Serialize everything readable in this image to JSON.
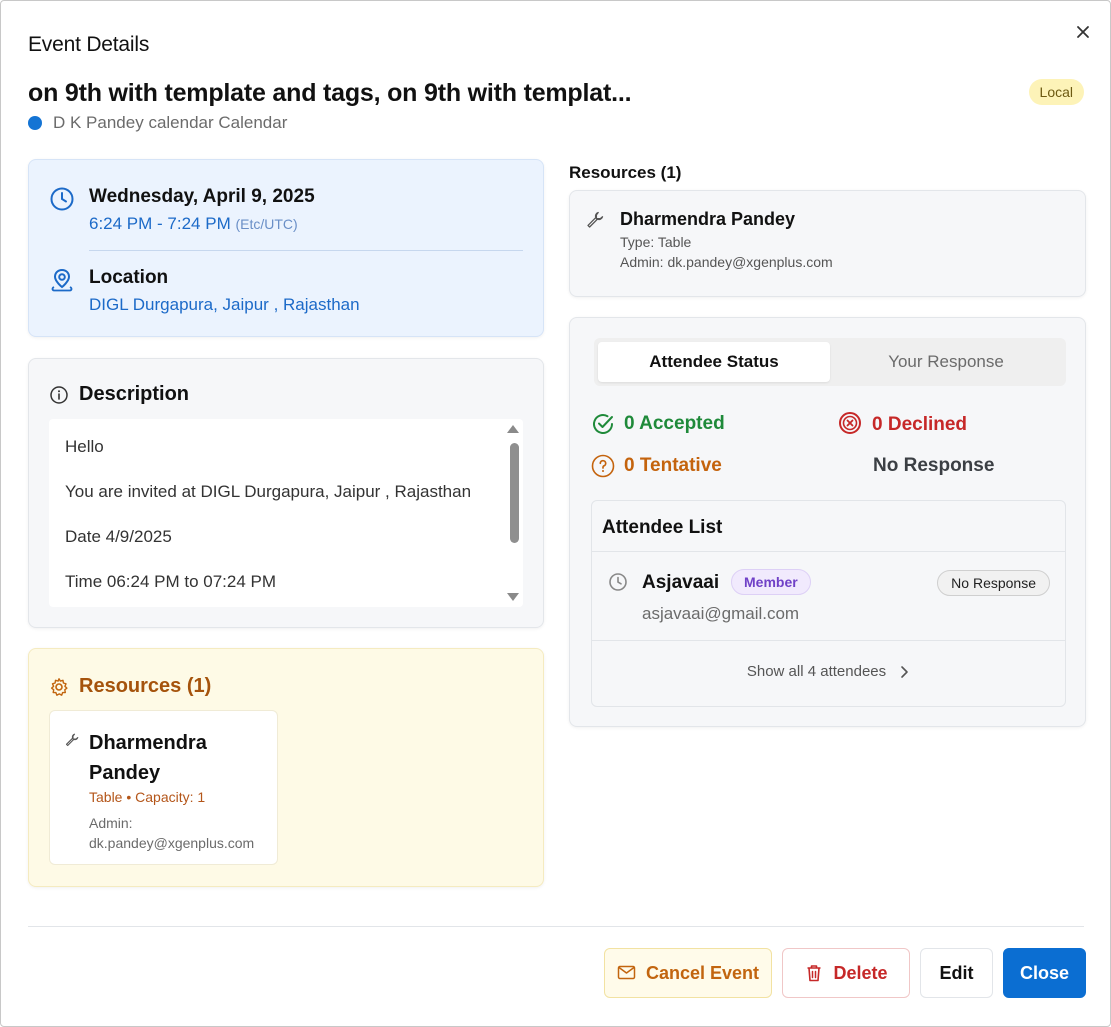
{
  "header": {
    "title": "Event Details"
  },
  "event": {
    "title": "on 9th with template and tags, on 9th with templat...",
    "badge": "Local",
    "calendar": "D K Pandey calendar Calendar"
  },
  "datetime": {
    "date": "Wednesday, April 9, 2025",
    "time": "6:24 PM - 7:24 PM",
    "timezone": "(Etc/UTC)"
  },
  "location": {
    "label": "Location",
    "value": "DIGL Durgapura, Jaipur , Rajasthan"
  },
  "description": {
    "label": "Description",
    "lines": [
      "Hello",
      "You are invited at DIGL Durgapura, Jaipur , Rajasthan",
      "Date 4/9/2025",
      "Time 06:24 PM to 07:24 PM"
    ]
  },
  "resources_left": {
    "label": "Resources (1)",
    "name": "Dharmendra Pandey",
    "meta": "Table • Capacity: 1",
    "admin_label": "Admin:",
    "admin_email": "dk.pandey@xgenplus.com"
  },
  "resources_right": {
    "label": "Resources (1)",
    "name": "Dharmendra Pandey",
    "type": "Type: Table",
    "admin": "Admin: dk.pandey@xgenplus.com"
  },
  "tabs": [
    {
      "label": "Attendee Status",
      "active": true
    },
    {
      "label": "Your Response",
      "active": false
    }
  ],
  "stats": {
    "accepted": "0 Accepted",
    "declined": "0 Declined",
    "tentative": "0 Tentative",
    "no_response": "No Response"
  },
  "attendee_list": {
    "title": "Attendee List",
    "attendees": [
      {
        "name": "Asjavaai",
        "role": "Member",
        "email": "asjavaai@gmail.com",
        "status": "No Response"
      }
    ],
    "show_all": "Show all 4 attendees"
  },
  "footer": {
    "cancel": "Cancel Event",
    "delete": "Delete",
    "edit": "Edit",
    "close": "Close"
  },
  "colors": {
    "primary": "#0b6ed2",
    "accepted": "#1f8a3a",
    "declined": "#c62828",
    "tentative": "#c4630d",
    "calendar_dot": "#1474d4"
  },
  "icons": {
    "close": "close-icon",
    "clock": "clock-icon",
    "location": "map-pin-icon",
    "info": "info-icon",
    "gear": "gear-icon",
    "wrench": "wrench-icon",
    "check": "check-circle-icon",
    "x": "x-circle-icon",
    "question": "question-circle-icon",
    "chevron": "chevron-right-icon",
    "mail": "mail-icon",
    "trash": "trash-icon"
  }
}
